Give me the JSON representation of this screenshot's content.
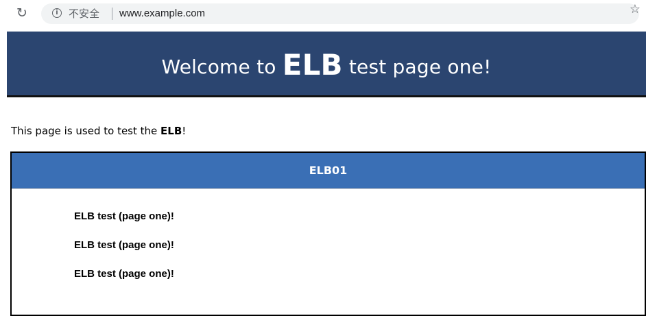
{
  "browser": {
    "reload_icon": "↻",
    "security_label": "不安全",
    "url": "www.example.com",
    "info_glyph": "i",
    "star_glyph": "☆"
  },
  "page": {
    "banner": {
      "prefix": "Welcome to ",
      "emphasis": "ELB",
      "suffix": " test page one!"
    },
    "intro": {
      "prefix": "This page is used to test the ",
      "emphasis": "ELB",
      "suffix": "!"
    },
    "panel": {
      "title": "ELB01",
      "lines": [
        "ELB test (page one)!",
        "ELB test (page one)!",
        "ELB test (page one)!"
      ]
    }
  },
  "colors": {
    "banner_bg": "#2b4570",
    "panel_header_bg": "#3a6fb5"
  }
}
